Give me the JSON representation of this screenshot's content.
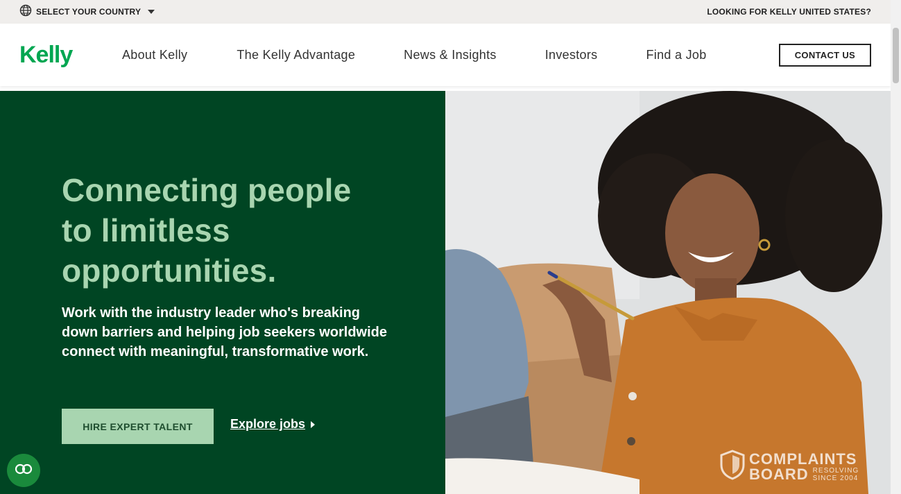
{
  "utility_bar": {
    "country_label": "SELECT YOUR COUNTRY",
    "right_link": "LOOKING FOR KELLY UNITED STATES?"
  },
  "header": {
    "logo": "Kelly",
    "nav": [
      {
        "label": "About Kelly"
      },
      {
        "label": "The Kelly Advantage"
      },
      {
        "label": "News & Insights"
      },
      {
        "label": "Investors"
      },
      {
        "label": "Find a Job"
      }
    ],
    "contact_label": "CONTACT US"
  },
  "hero": {
    "title": "Connecting people to limitless opportunities.",
    "subtitle": "Work with the industry leader who's breaking down barriers and helping job seekers worldwide connect with meaningful, transformative work.",
    "primary_cta": "HIRE EXPERT TALENT",
    "secondary_cta": "Explore jobs"
  },
  "watermark": {
    "line1": "COMPLAINTS",
    "line2": "BOARD",
    "tag1": "RESOLVING",
    "tag2": "SINCE 2004"
  },
  "colors": {
    "brand_green": "#00a651",
    "hero_bg": "#004523",
    "hero_accent": "#a8d5b0"
  },
  "icons": {
    "globe": "globe-icon",
    "chat": "chat-icon",
    "caret": "chevron-down-icon"
  }
}
